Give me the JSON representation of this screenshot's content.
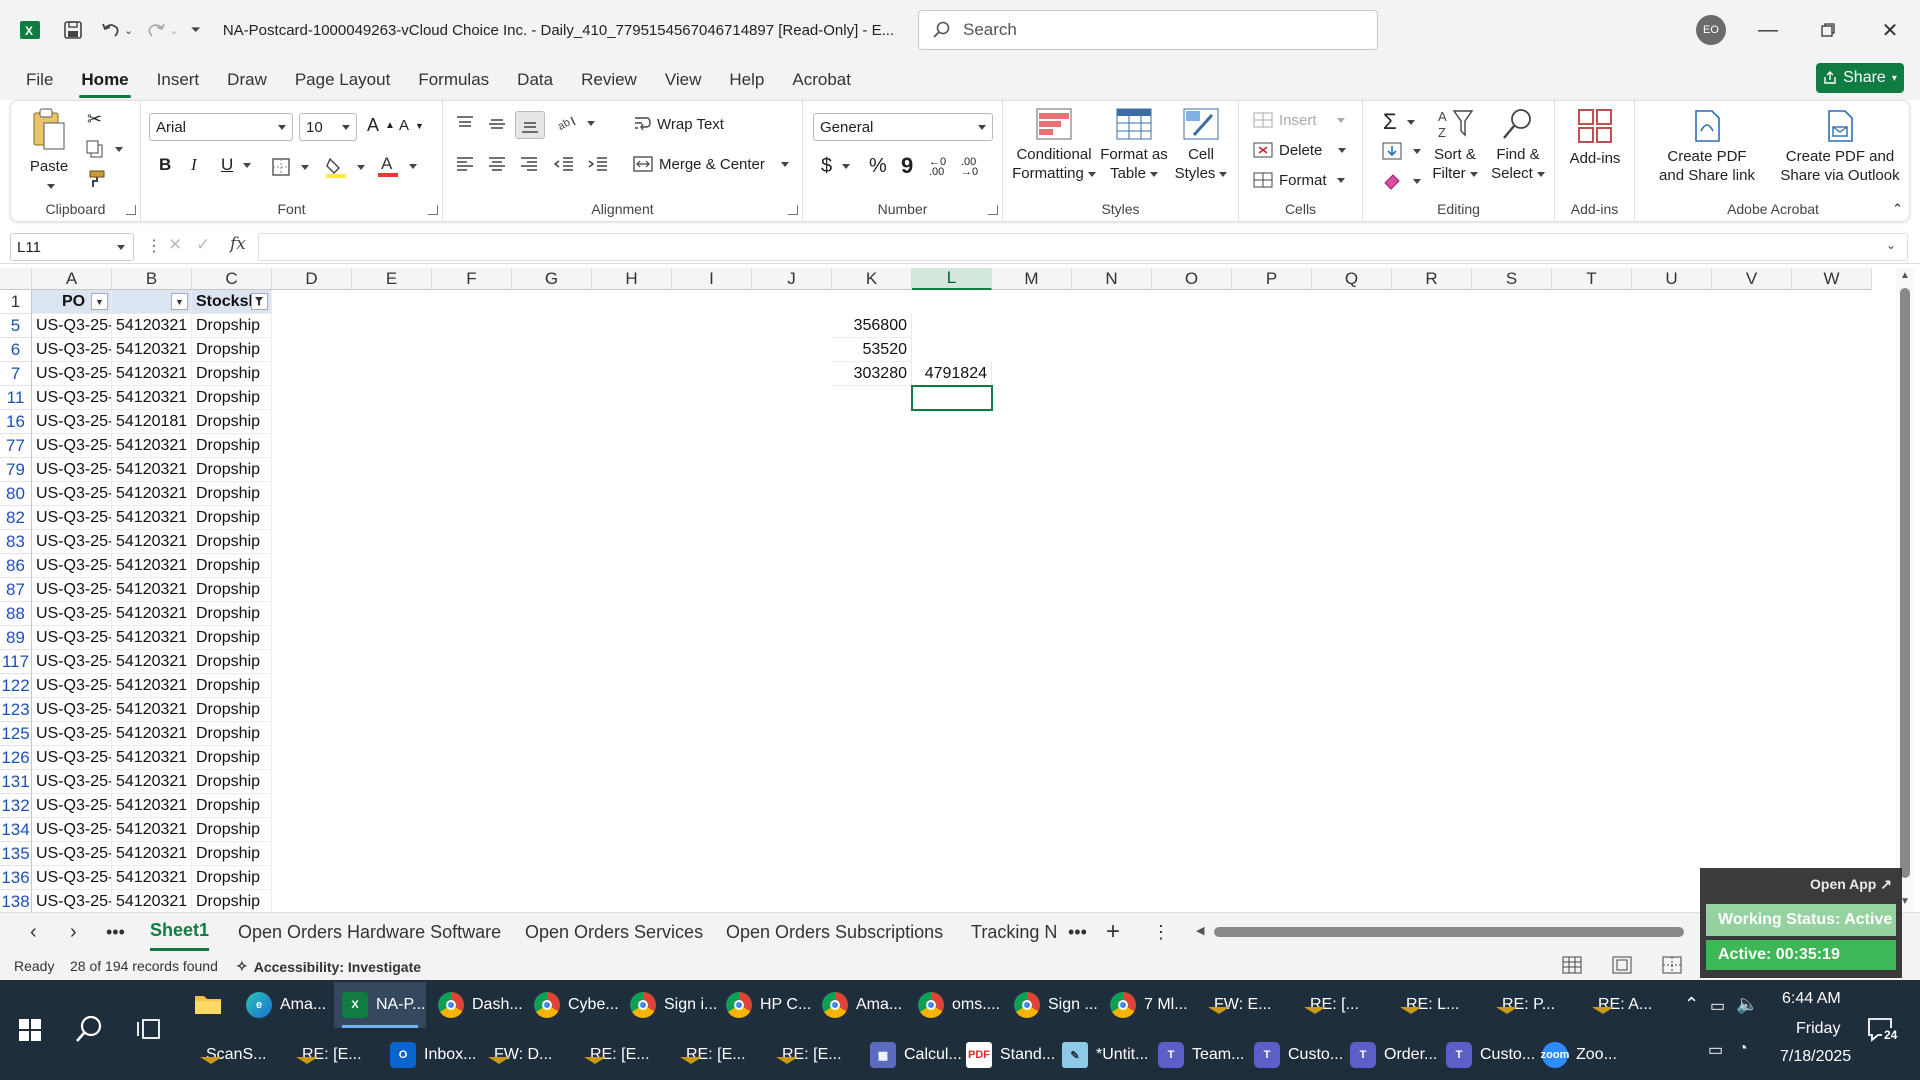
{
  "titlebar": {
    "filename": "NA-Postcard-1000049263-vCloud Choice Inc. - Daily_410_7795154567046714897  [Read-Only]  -  E...",
    "search_placeholder": "Search",
    "avatar_initials": "EO"
  },
  "menu": {
    "tabs": [
      "File",
      "Home",
      "Insert",
      "Draw",
      "Page Layout",
      "Formulas",
      "Data",
      "Review",
      "View",
      "Help",
      "Acrobat"
    ],
    "active": "Home",
    "share_label": "Share"
  },
  "ribbon": {
    "clipboard": {
      "label": "Clipboard",
      "paste": "Paste"
    },
    "font": {
      "label": "Font",
      "name": "Arial",
      "size": "10"
    },
    "alignment": {
      "label": "Alignment",
      "wrap": "Wrap Text",
      "merge": "Merge & Center"
    },
    "number": {
      "label": "Number",
      "format": "General"
    },
    "styles": {
      "label": "Styles",
      "conditional": [
        "Conditional",
        "Formatting"
      ],
      "format_table": [
        "Format as",
        "Table"
      ],
      "cell_styles": [
        "Cell",
        "Styles"
      ]
    },
    "cells": {
      "label": "Cells",
      "insert": "Insert",
      "delete": "Delete",
      "format": "Format"
    },
    "editing": {
      "label": "Editing",
      "sort": [
        "Sort &",
        "Filter"
      ],
      "find": [
        "Find &",
        "Select"
      ]
    },
    "addins": {
      "label": "Add-ins",
      "btn": "Add-ins"
    },
    "acrobat": {
      "label": "Adobe Acrobat",
      "pdf_share": [
        "Create PDF",
        "and Share link"
      ],
      "pdf_outlook": [
        "Create PDF and",
        "Share via Outlook"
      ]
    }
  },
  "formula_bar": {
    "name_box": "L11",
    "fx": "fx",
    "formula": ""
  },
  "columns": [
    "A",
    "B",
    "C",
    "D",
    "E",
    "F",
    "G",
    "H",
    "I",
    "J",
    "K",
    "L",
    "M",
    "N",
    "O",
    "P",
    "Q",
    "R",
    "S",
    "T",
    "U",
    "V",
    "W"
  ],
  "selected_column": "L",
  "header_row": {
    "row": "1",
    "A": "PO",
    "B": "",
    "C": "Stocksh"
  },
  "rows": [
    {
      "row": "5",
      "A": "US-Q3-25-",
      "B": "54120321",
      "C": "Dropship",
      "K": "356800",
      "L": ""
    },
    {
      "row": "6",
      "A": "US-Q3-25-",
      "B": "54120321",
      "C": "Dropship",
      "K": "53520",
      "L": ""
    },
    {
      "row": "7",
      "A": "US-Q3-25-",
      "B": "54120321",
      "C": "Dropship",
      "K": "303280",
      "L": "4791824"
    },
    {
      "row": "11",
      "A": "US-Q3-25-",
      "B": "54120321",
      "C": "Dropship",
      "K": "",
      "L": ""
    },
    {
      "row": "16",
      "A": "US-Q3-25-",
      "B": "54120181",
      "C": "Dropship",
      "K": "",
      "L": ""
    },
    {
      "row": "77",
      "A": "US-Q3-25-",
      "B": "54120321",
      "C": "Dropship",
      "K": "",
      "L": ""
    },
    {
      "row": "79",
      "A": "US-Q3-25-",
      "B": "54120321",
      "C": "Dropship",
      "K": "",
      "L": ""
    },
    {
      "row": "80",
      "A": "US-Q3-25-",
      "B": "54120321",
      "C": "Dropship",
      "K": "",
      "L": ""
    },
    {
      "row": "82",
      "A": "US-Q3-25-",
      "B": "54120321",
      "C": "Dropship",
      "K": "",
      "L": ""
    },
    {
      "row": "83",
      "A": "US-Q3-25-",
      "B": "54120321",
      "C": "Dropship",
      "K": "",
      "L": ""
    },
    {
      "row": "86",
      "A": "US-Q3-25-",
      "B": "54120321",
      "C": "Dropship",
      "K": "",
      "L": ""
    },
    {
      "row": "87",
      "A": "US-Q3-25-",
      "B": "54120321",
      "C": "Dropship",
      "K": "",
      "L": ""
    },
    {
      "row": "88",
      "A": "US-Q3-25-",
      "B": "54120321",
      "C": "Dropship",
      "K": "",
      "L": ""
    },
    {
      "row": "89",
      "A": "US-Q3-25-",
      "B": "54120321",
      "C": "Dropship",
      "K": "",
      "L": ""
    },
    {
      "row": "117",
      "A": "US-Q3-25-",
      "B": "54120321",
      "C": "Dropship",
      "K": "",
      "L": ""
    },
    {
      "row": "122",
      "A": "US-Q3-25-",
      "B": "54120321",
      "C": "Dropship",
      "K": "",
      "L": ""
    },
    {
      "row": "123",
      "A": "US-Q3-25-",
      "B": "54120321",
      "C": "Dropship",
      "K": "",
      "L": ""
    },
    {
      "row": "125",
      "A": "US-Q3-25-",
      "B": "54120321",
      "C": "Dropship",
      "K": "",
      "L": ""
    },
    {
      "row": "126",
      "A": "US-Q3-25-",
      "B": "54120321",
      "C": "Dropship",
      "K": "",
      "L": ""
    },
    {
      "row": "131",
      "A": "US-Q3-25-",
      "B": "54120321",
      "C": "Dropship",
      "K": "",
      "L": ""
    },
    {
      "row": "132",
      "A": "US-Q3-25-",
      "B": "54120321",
      "C": "Dropship",
      "K": "",
      "L": ""
    },
    {
      "row": "134",
      "A": "US-Q3-25-",
      "B": "54120321",
      "C": "Dropship",
      "K": "",
      "L": ""
    },
    {
      "row": "135",
      "A": "US-Q3-25-",
      "B": "54120321",
      "C": "Dropship",
      "K": "",
      "L": ""
    },
    {
      "row": "136",
      "A": "US-Q3-25-",
      "B": "54120321",
      "C": "Dropship",
      "K": "",
      "L": ""
    },
    {
      "row": "138",
      "A": "US-Q3-25-",
      "B": "54120321",
      "C": "Dropship",
      "K": "",
      "L": ""
    }
  ],
  "sheets": [
    "Sheet1",
    "Open Orders Hardware Software",
    "Open Orders Services",
    "Open Orders Subscriptions",
    "Tracking N"
  ],
  "active_sheet": "Sheet1",
  "status": {
    "ready": "Ready",
    "records": "28 of 194 records found",
    "accessibility": "Accessibility: Investigate"
  },
  "overlay": {
    "open_app": "Open App ↗",
    "working_status": "Working Status: Active",
    "active_time": "Active: 00:35:19"
  },
  "taskbar": {
    "row1": [
      {
        "icon": "edge",
        "label": "Ama..."
      },
      {
        "icon": "excel",
        "label": "NA-P..."
      },
      {
        "icon": "chrome",
        "label": "Dash..."
      },
      {
        "icon": "chrome",
        "label": "Cybe..."
      },
      {
        "icon": "chrome",
        "label": "Sign i..."
      },
      {
        "icon": "chrome",
        "label": "HP C..."
      },
      {
        "icon": "chrome",
        "label": "Ama..."
      },
      {
        "icon": "chrome",
        "label": "oms...."
      },
      {
        "icon": "chrome",
        "label": "Sign ..."
      },
      {
        "icon": "chrome",
        "label": "7 Ml..."
      },
      {
        "icon": "mail",
        "label": "FW: E..."
      },
      {
        "icon": "mail",
        "label": "RE: [..."
      },
      {
        "icon": "mail",
        "label": "RE: L..."
      },
      {
        "icon": "mail",
        "label": "RE: P..."
      },
      {
        "icon": "mail",
        "label": "RE: A..."
      }
    ],
    "row2": [
      {
        "icon": "mail",
        "label": "ScanS..."
      },
      {
        "icon": "mail",
        "label": "RE: [E..."
      },
      {
        "icon": "outlook",
        "label": "Inbox..."
      },
      {
        "icon": "mail",
        "label": "FW: D..."
      },
      {
        "icon": "mail",
        "label": "RE: [E..."
      },
      {
        "icon": "mail",
        "label": "RE: [E..."
      },
      {
        "icon": "mail",
        "label": "RE: [E..."
      },
      {
        "icon": "calc",
        "label": "Calcul..."
      },
      {
        "icon": "pdf",
        "label": "Stand..."
      },
      {
        "icon": "notepad",
        "label": "*Untit..."
      },
      {
        "icon": "teams",
        "label": "Team..."
      },
      {
        "icon": "teams",
        "label": "Custo..."
      },
      {
        "icon": "teams",
        "label": "Order..."
      },
      {
        "icon": "teams",
        "label": "Custo..."
      },
      {
        "icon": "zoom",
        "label": "Zoo..."
      }
    ],
    "time": "6:44 AM",
    "day": "Friday",
    "date": "7/18/2025",
    "notifications": "24"
  }
}
